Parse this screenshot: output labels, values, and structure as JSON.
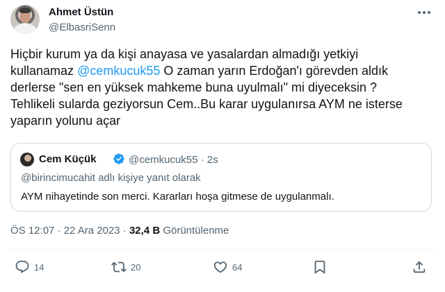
{
  "author": {
    "name": "Ahmet Üstün",
    "handle": "@ElbasriSenn"
  },
  "tweet": {
    "line1": "Hiçbir kurum ya da kişi anayasa ve yasalardan almadığı yetkiyi",
    "line2_pre": "kullanamaz ",
    "mention": "@cemkucuk55",
    "line2_post": " O zaman yarın Erdoğan'ı görevden aldık",
    "line3": "derlerse \"sen en yüksek mahkeme buna uyulmalı\" mi diyeceksin ?",
    "line4": "Tehlikeli sularda geziyorsun Cem..Bu karar uygulanırsa AYM ne isterse",
    "line5": "yaparın yolunu açar"
  },
  "quote": {
    "name": "Cem Küçük",
    "meta": "@cemkucuk55 · 2s",
    "reply_context": "@birincimucahit adlı kişiye yanıt olarak",
    "text": "AYM nihayetinde son merci. Kararları hoşa gitmese de uygulanmalı."
  },
  "meta": {
    "time_date": "ÖS 12:07 · 22 Ara 2023 · ",
    "views_count": "32,4 B",
    "views_label": " Görüntülenme"
  },
  "actions": {
    "replies": "14",
    "retweets": "20",
    "likes": "64",
    "icons": [
      "reply-icon",
      "retweet-icon",
      "like-icon",
      "bookmark-icon",
      "share-icon"
    ]
  },
  "colors": {
    "accent": "#1d9bf0",
    "secondary_text": "#536471",
    "border": "#cfd9de"
  }
}
